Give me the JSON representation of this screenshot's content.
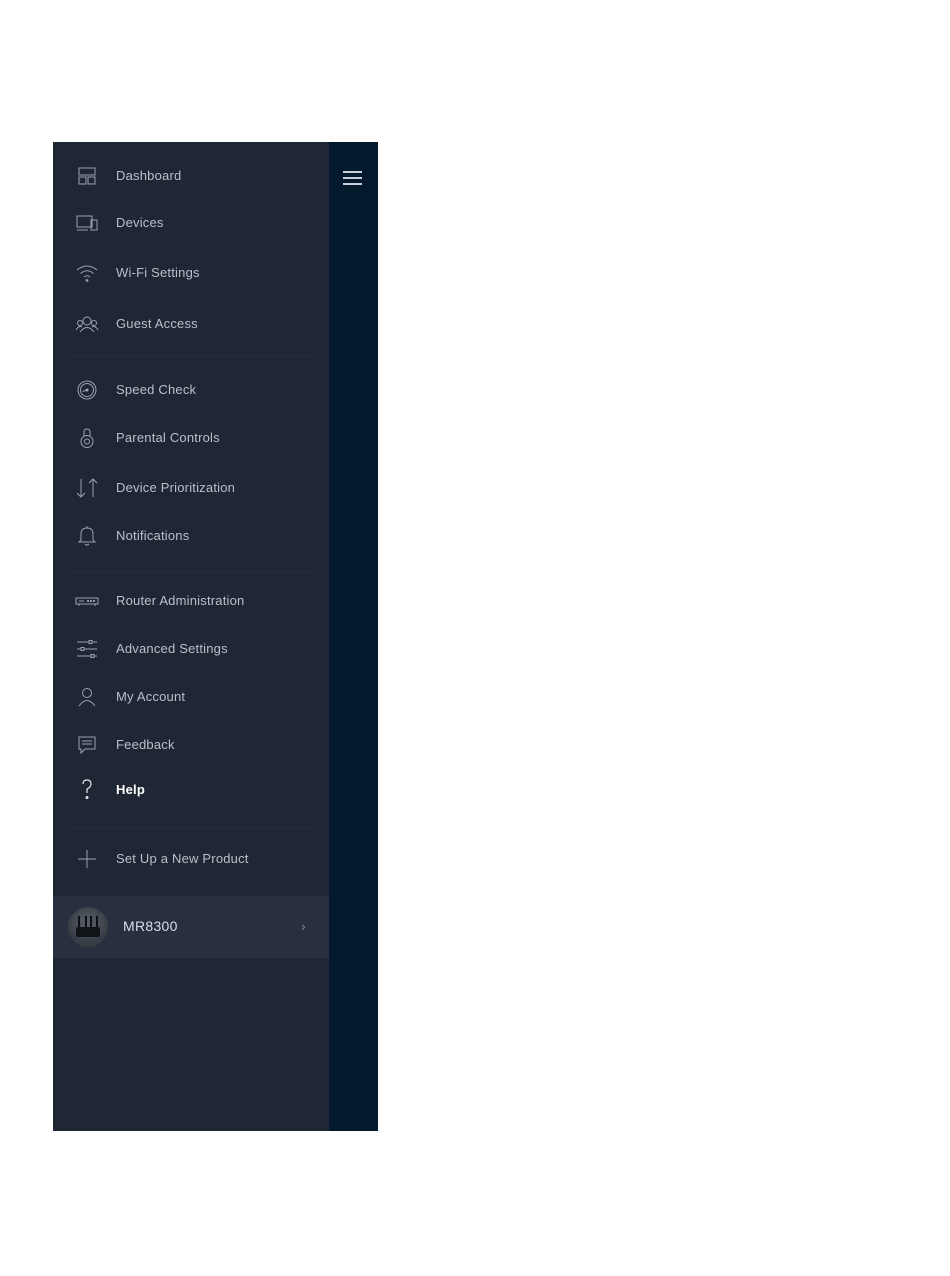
{
  "menu": {
    "items": [
      {
        "label": "Dashboard",
        "icon": "dashboard-icon"
      },
      {
        "label": "Devices",
        "icon": "devices-icon"
      },
      {
        "label": "Wi-Fi Settings",
        "icon": "wifi-icon"
      },
      {
        "label": "Guest Access",
        "icon": "guest-access-icon"
      },
      {
        "label": "Speed Check",
        "icon": "speed-check-icon"
      },
      {
        "label": "Parental Controls",
        "icon": "parental-controls-icon"
      },
      {
        "label": "Device Prioritization",
        "icon": "prioritization-arrows-icon"
      },
      {
        "label": "Notifications",
        "icon": "bell-icon"
      },
      {
        "label": "Router Administration",
        "icon": "router-icon"
      },
      {
        "label": "Advanced Settings",
        "icon": "sliders-icon"
      },
      {
        "label": "My Account",
        "icon": "user-icon"
      },
      {
        "label": "Feedback",
        "icon": "feedback-icon"
      },
      {
        "label": "Help",
        "icon": "help-icon",
        "active": true
      },
      {
        "label": "Set Up a New Product",
        "icon": "plus-icon"
      }
    ]
  },
  "device": {
    "name": "MR8300",
    "chevron": "›"
  },
  "colors": {
    "menu_background": "#1f2634",
    "side_strip": "#03192c",
    "device_row": "#283040",
    "label_text": "#b8c0cc",
    "active_label": "#ffffff",
    "page_background": "#ffffff"
  }
}
